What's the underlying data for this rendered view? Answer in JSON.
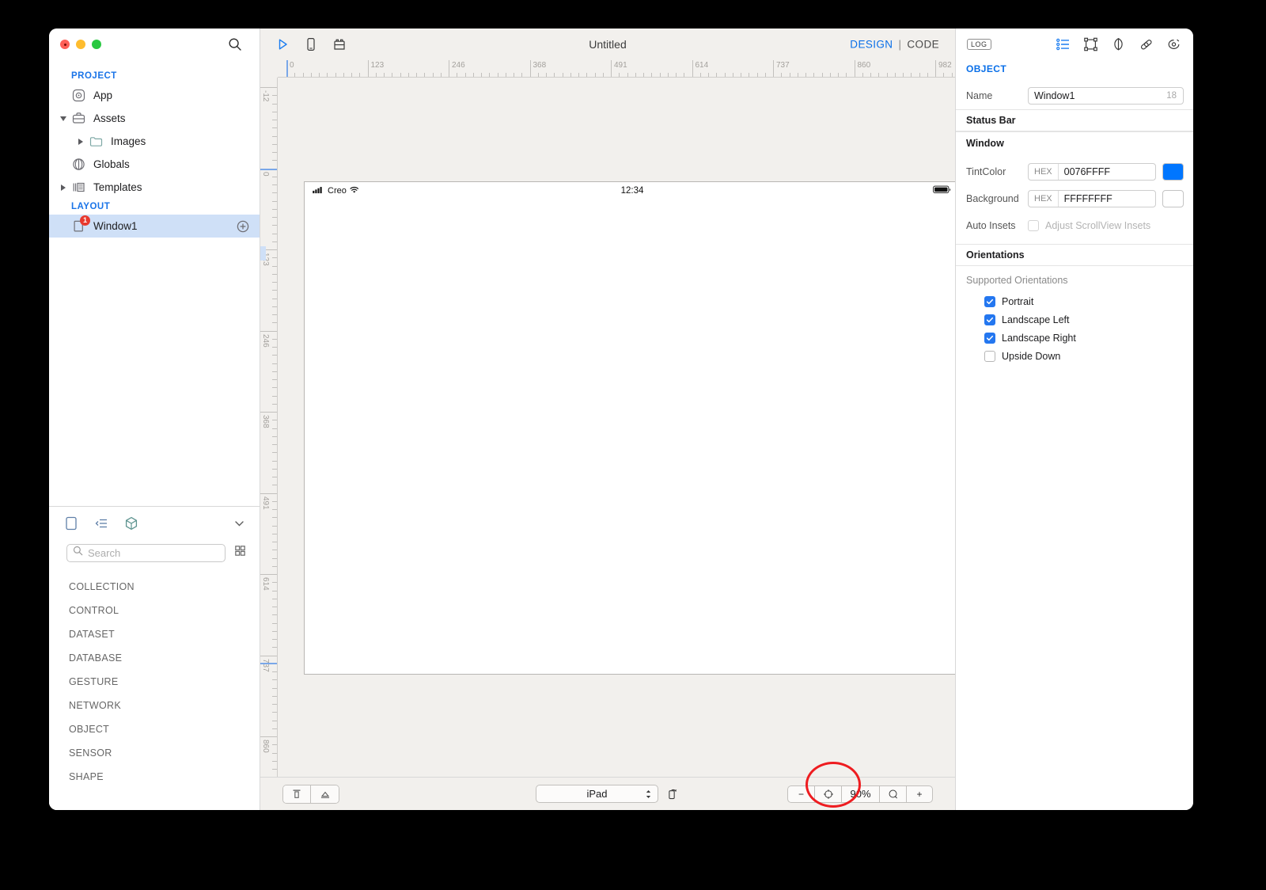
{
  "sidebar": {
    "search_icon": "search-icon",
    "sections": [
      {
        "title": "PROJECT",
        "items": [
          {
            "label": "App",
            "icon": "app-icon",
            "indent": 0,
            "disclosure": "none"
          },
          {
            "label": "Assets",
            "icon": "briefcase-icon",
            "indent": 0,
            "disclosure": "open"
          },
          {
            "label": "Images",
            "icon": "folder-icon",
            "indent": 1,
            "disclosure": "closed"
          },
          {
            "label": "Globals",
            "icon": "globals-icon",
            "indent": 0,
            "disclosure": "none"
          },
          {
            "label": "Templates",
            "icon": "templates-icon",
            "indent": 0,
            "disclosure": "closed"
          }
        ]
      },
      {
        "title": "LAYOUT",
        "items": [
          {
            "label": "Window1",
            "icon": "window-icon",
            "indent": 0,
            "disclosure": "none",
            "badge": "1",
            "selected": true,
            "add_button": "add-icon"
          }
        ]
      }
    ]
  },
  "library": {
    "tabs": [
      {
        "name": "layout-tab-icon",
        "active": true
      },
      {
        "name": "outline-tab-icon",
        "active": false
      },
      {
        "name": "object-tab-icon",
        "active": false
      }
    ],
    "collapse_icon": "chevron-down-icon",
    "search": {
      "placeholder": "Search",
      "value": "",
      "icon": "search-icon"
    },
    "grid_icon": "grid-view-icon",
    "items": [
      "COLLECTION",
      "CONTROL",
      "DATASET",
      "DATABASE",
      "GESTURE",
      "NETWORK",
      "OBJECT",
      "SENSOR",
      "SHAPE"
    ]
  },
  "canvas": {
    "toolbar": {
      "icons": [
        "play-icon",
        "device-icon",
        "widgets-icon"
      ],
      "title": "Untitled",
      "mode_design": "DESIGN",
      "mode_separator": "|",
      "mode_code": "CODE"
    },
    "ruler": {
      "h_labels": [
        "0",
        "123",
        "246",
        "368",
        "491",
        "614",
        "737",
        "860",
        "982"
      ],
      "v_labels": [
        "-12",
        "0",
        "123",
        "246",
        "368",
        "491",
        "614",
        "737",
        "860"
      ]
    },
    "device_preview": {
      "status_bar": {
        "signal_icon": "cellular-signal-icon",
        "carrier": "Creo",
        "wifi_icon": "wifi-icon",
        "time": "12:34",
        "battery_icon": "battery-full-icon"
      }
    },
    "bottom_bar": {
      "left_buttons": [
        "align-top-icon",
        "align-bottom-icon"
      ],
      "device_select": {
        "value": "iPad",
        "stepper_icon": "stepper-icon"
      },
      "rotate_icon": "rotate-device-icon",
      "zoom": {
        "minus": "−",
        "fit_icon": "zoom-fit-icon",
        "level": "90%",
        "actual_icon": "zoom-actual-icon",
        "plus": "+"
      }
    }
  },
  "inspector": {
    "log_button": "LOG",
    "icons": [
      "list-inspector-icon",
      "layout-inspector-icon",
      "style-inspector-icon",
      "link-inspector-icon",
      "events-inspector-icon"
    ],
    "title": "OBJECT",
    "name_label": "Name",
    "name_value": "Window1",
    "name_suffix": "18",
    "groups": [
      {
        "header": "Status Bar"
      },
      {
        "header": "Window"
      }
    ],
    "tint_label": "TintColor",
    "tint_hex_tag": "HEX",
    "tint_hex_value": "0076FFFF",
    "tint_swatch_color": "#0076ff",
    "background_label": "Background",
    "background_hex_tag": "HEX",
    "background_hex_value": "FFFFFFFF",
    "background_swatch_color": "#ffffff",
    "auto_insets_label": "Auto Insets",
    "auto_insets_option": "Adjust ScrollView Insets",
    "auto_insets_checked": false,
    "orientations_header": "Orientations",
    "supported_orientations_label": "Supported Orientations",
    "orientations": [
      {
        "label": "Portrait",
        "checked": true
      },
      {
        "label": "Landscape Left",
        "checked": true
      },
      {
        "label": "Landscape Right",
        "checked": true
      },
      {
        "label": "Upside Down",
        "checked": false
      }
    ]
  },
  "colors": {
    "accent": "#0a6fe8",
    "checkbox_blue": "#2477f0",
    "highlight_red": "#ee1c20",
    "selection_blue": "#cfe0f7"
  }
}
